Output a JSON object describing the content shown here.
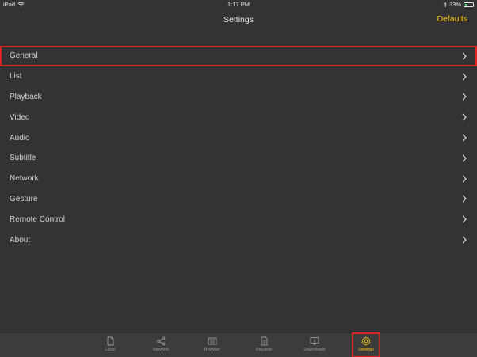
{
  "status_bar": {
    "device": "iPad",
    "time": "1:17 PM",
    "battery": "33%",
    "battery_fill_percent": 33
  },
  "nav_bar": {
    "title": "Settings",
    "defaults_label": "Defaults"
  },
  "settings": {
    "items": [
      {
        "label": "General"
      },
      {
        "label": "List"
      },
      {
        "label": "Playback"
      },
      {
        "label": "Video"
      },
      {
        "label": "Audio"
      },
      {
        "label": "Subtitle"
      },
      {
        "label": "Network"
      },
      {
        "label": "Gesture"
      },
      {
        "label": "Remote Control"
      },
      {
        "label": "About"
      }
    ]
  },
  "tab_bar": {
    "tabs": [
      {
        "label": "Local",
        "icon": "file-icon"
      },
      {
        "label": "Network",
        "icon": "share-icon"
      },
      {
        "label": "Browser",
        "icon": "browser-icon"
      },
      {
        "label": "Playlists",
        "icon": "playlist-icon"
      },
      {
        "label": "Downloads",
        "icon": "download-icon"
      },
      {
        "label": "Settings",
        "icon": "gear-icon"
      }
    ]
  },
  "colors": {
    "background": "#333333",
    "accent": "#f5c518",
    "highlight_border": "#e02424"
  }
}
